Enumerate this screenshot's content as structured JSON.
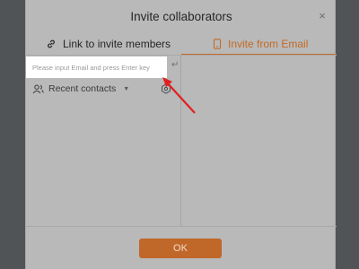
{
  "dialog": {
    "title": "Invite collaborators",
    "close_icon": "close-icon",
    "close_label": "×"
  },
  "tabs": [
    {
      "label": "Link to invite members",
      "icon": "link-icon",
      "active": false
    },
    {
      "label": "Invite from Email",
      "icon": "phone-icon",
      "active": true
    }
  ],
  "email": {
    "placeholder": "Please input Email and press Enter key",
    "value": "",
    "enter_icon": "enter-key-icon"
  },
  "recent_contacts": {
    "label": "Recent contacts",
    "icon": "contacts-icon",
    "dropdown_icon": "caret-down-icon",
    "settings_icon": "hexagon-icon"
  },
  "footer": {
    "ok_label": "OK"
  },
  "annotation": {
    "icon": "red-arrow-icon",
    "color": "#e02020"
  },
  "colors": {
    "accent": "#c36a26",
    "ok_button": "#c0672a",
    "overlay_dialog": "#b9b9b9"
  }
}
